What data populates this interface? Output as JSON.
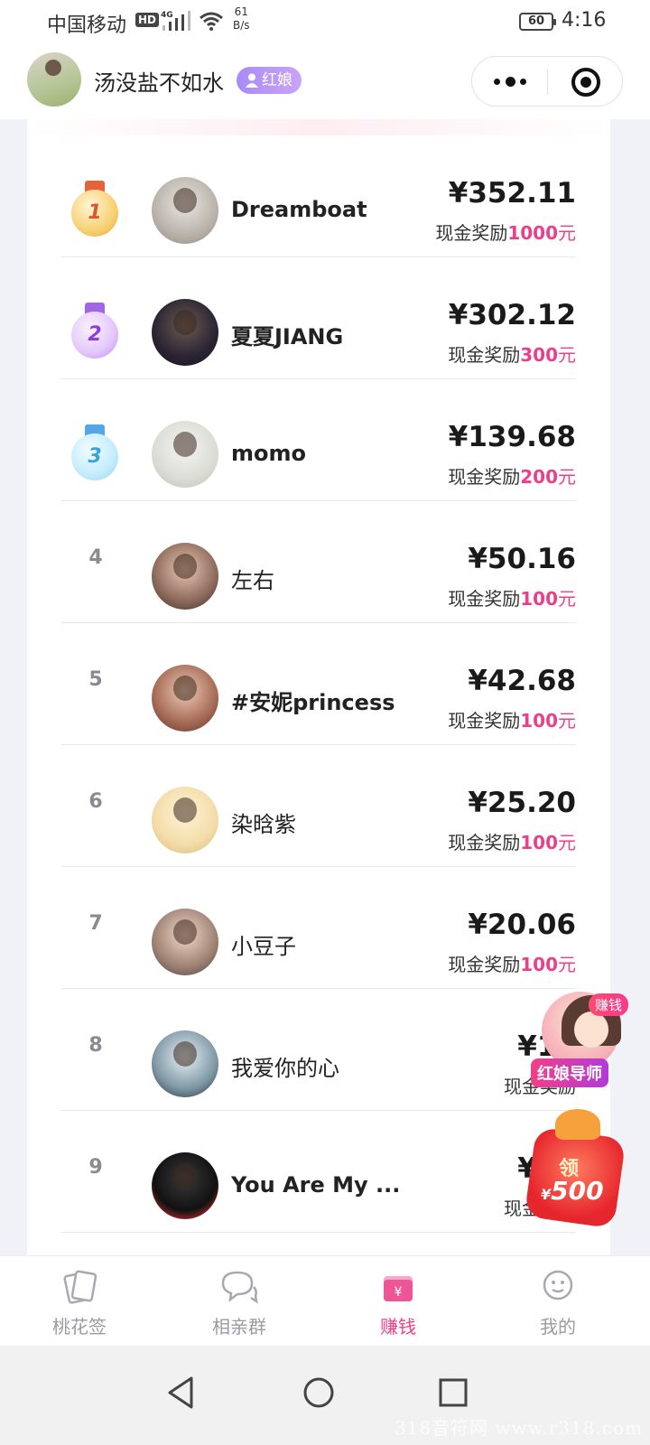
{
  "status_bar": {
    "carrier": "中国移动",
    "hd": "HD",
    "network": "4G",
    "speed_value": "61",
    "speed_unit": "B/s",
    "battery": "60",
    "time": "4:16"
  },
  "header": {
    "name": "汤没盐不如水",
    "badge": "红娘"
  },
  "ranking": [
    {
      "rank": "1",
      "name": "Dreamboat",
      "amount": "¥352.11",
      "reward_prefix": "现金奖励",
      "reward_amount": "1000",
      "reward_unit": "元"
    },
    {
      "rank": "2",
      "name": "夏夏JIANG",
      "amount": "¥302.12",
      "reward_prefix": "现金奖励",
      "reward_amount": "300",
      "reward_unit": "元"
    },
    {
      "rank": "3",
      "name": "momo",
      "amount": "¥139.68",
      "reward_prefix": "现金奖励",
      "reward_amount": "200",
      "reward_unit": "元"
    },
    {
      "rank": "4",
      "name": "左右",
      "amount": "¥50.16",
      "reward_prefix": "现金奖励",
      "reward_amount": "100",
      "reward_unit": "元"
    },
    {
      "rank": "5",
      "name": "#安妮princess",
      "amount": "¥42.68",
      "reward_prefix": "现金奖励",
      "reward_amount": "100",
      "reward_unit": "元"
    },
    {
      "rank": "6",
      "name": "染晗紫",
      "amount": "¥25.20",
      "reward_prefix": "现金奖励",
      "reward_amount": "100",
      "reward_unit": "元"
    },
    {
      "rank": "7",
      "name": "小豆子",
      "amount": "¥20.06",
      "reward_prefix": "现金奖励",
      "reward_amount": "100",
      "reward_unit": "元"
    },
    {
      "rank": "8",
      "name": "我爱你的心",
      "amount": "¥14",
      "reward_prefix": "现金奖励",
      "reward_amount": "",
      "reward_unit": ""
    },
    {
      "rank": "9",
      "name": "You Are My ...",
      "amount": "¥10",
      "reward_prefix": "现金奖励",
      "reward_amount": "",
      "reward_unit": ""
    }
  ],
  "floating": {
    "guide_tag": "赚钱",
    "guide_label": "红娘导师",
    "coupon_title": "领",
    "coupon_currency": "¥",
    "coupon_value": "500"
  },
  "tabs": [
    {
      "label": "桃花签",
      "icon": "card-icon"
    },
    {
      "label": "相亲群",
      "icon": "chat-icon"
    },
    {
      "label": "赚钱",
      "icon": "wallet-icon"
    },
    {
      "label": "我的",
      "icon": "smiley-icon"
    }
  ],
  "active_tab": "赚钱",
  "colors": {
    "accent": "#ec3f8b",
    "badge": "#a98bf5"
  },
  "watermark": "318音符网 www.r318.com"
}
